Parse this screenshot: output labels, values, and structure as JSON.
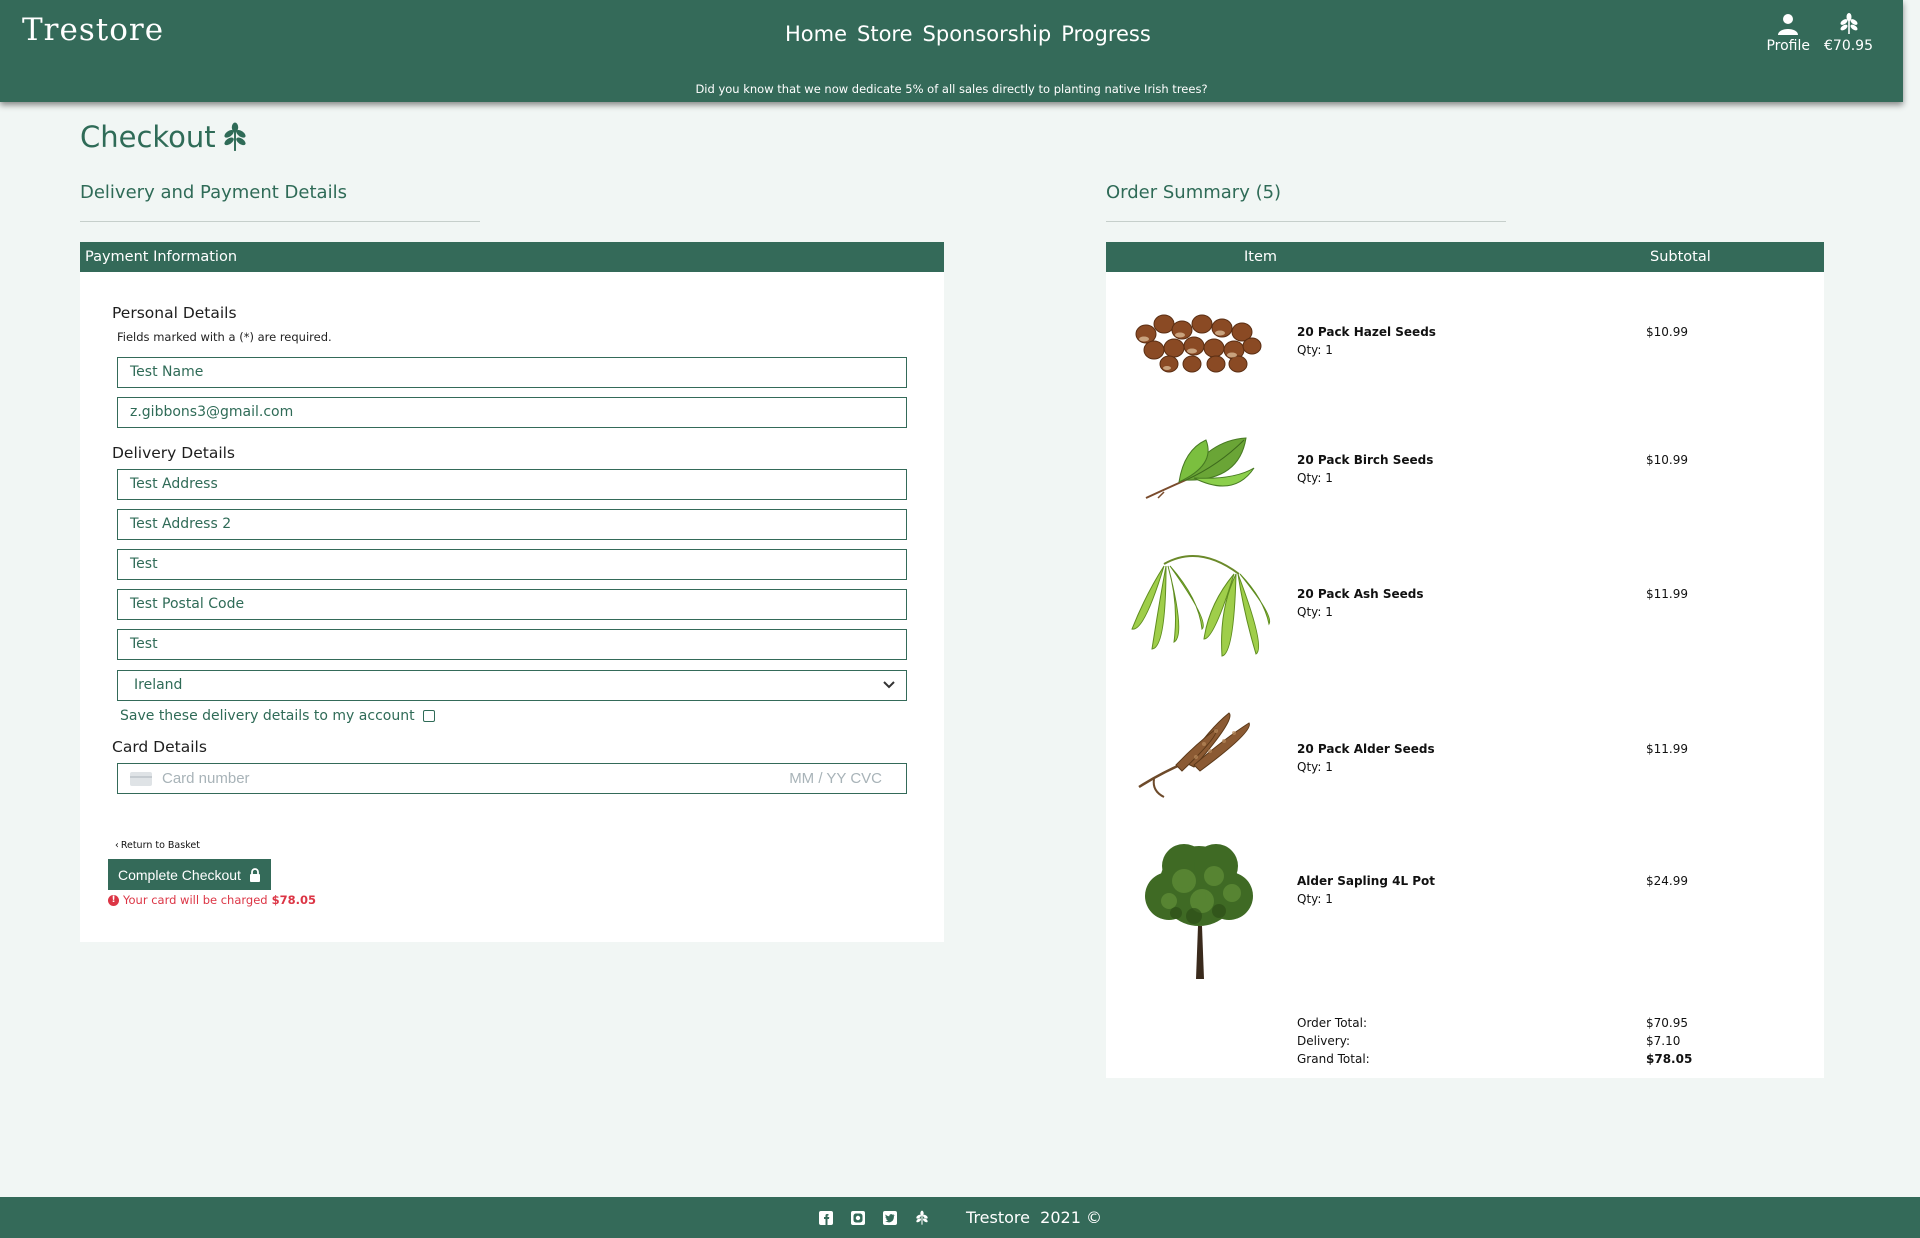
{
  "header": {
    "logo": "Trestore",
    "nav": [
      "Home",
      "Store",
      "Sponsorship",
      "Progress"
    ],
    "profile_label": "Profile",
    "basket_total": "€70.95",
    "banner": "Did you know that we now dedicate 5% of all sales directly to planting native Irish trees?"
  },
  "page": {
    "title": "Checkout",
    "left_heading": "Delivery and Payment Details",
    "right_heading": "Order Summary (5)"
  },
  "payment": {
    "card_header": "Payment Information",
    "personal_heading": "Personal Details",
    "required_note": "Fields marked with a (*) are required.",
    "full_name": "Test Name",
    "email": "z.gibbons3@gmail.com",
    "delivery_heading": "Delivery Details",
    "street1": "Test Address",
    "street2": "Test Address 2",
    "town": "Test",
    "postcode": "Test Postal Code",
    "county": "Test",
    "country": "Ireland",
    "save_label": "Save these delivery details to my account",
    "card_heading": "Card Details",
    "card_placeholder": "Card number",
    "card_expiry_cvc": "MM / YY  CVC",
    "back_link": "Return to Basket",
    "checkout_button": "Complete Checkout",
    "charge_text": "Your card will be charged",
    "charge_amount": "$78.05"
  },
  "summary": {
    "col_item": "Item",
    "col_subtotal": "Subtotal",
    "items": [
      {
        "name": "20 Pack Hazel Seeds",
        "qty": "Qty: 1",
        "price": "$10.99",
        "image": "hazelnuts"
      },
      {
        "name": "20 Pack Birch Seeds",
        "qty": "Qty: 1",
        "price": "$10.99",
        "image": "birch-leaves"
      },
      {
        "name": "20 Pack Ash Seeds",
        "qty": "Qty: 1",
        "price": "$11.99",
        "image": "ash-keys"
      },
      {
        "name": "20 Pack Alder Seeds",
        "qty": "Qty: 1",
        "price": "$11.99",
        "image": "alder-catkins"
      },
      {
        "name": "Alder Sapling 4L Pot",
        "qty": "Qty: 1",
        "price": "$24.99",
        "image": "tree"
      }
    ],
    "order_total_label": "Order Total:",
    "order_total": "$70.95",
    "delivery_label": "Delivery:",
    "delivery": "$7.10",
    "grand_total_label": "Grand Total:",
    "grand_total": "$78.05"
  },
  "footer": {
    "text": "Trestore  2021 ©",
    "icons": [
      "facebook-icon",
      "instagram-icon",
      "twitter-icon",
      "leaf-icon"
    ]
  },
  "colors": {
    "brand_green": "#346a59",
    "page_bg": "#f1f6f4",
    "error_red": "#dc3545"
  }
}
